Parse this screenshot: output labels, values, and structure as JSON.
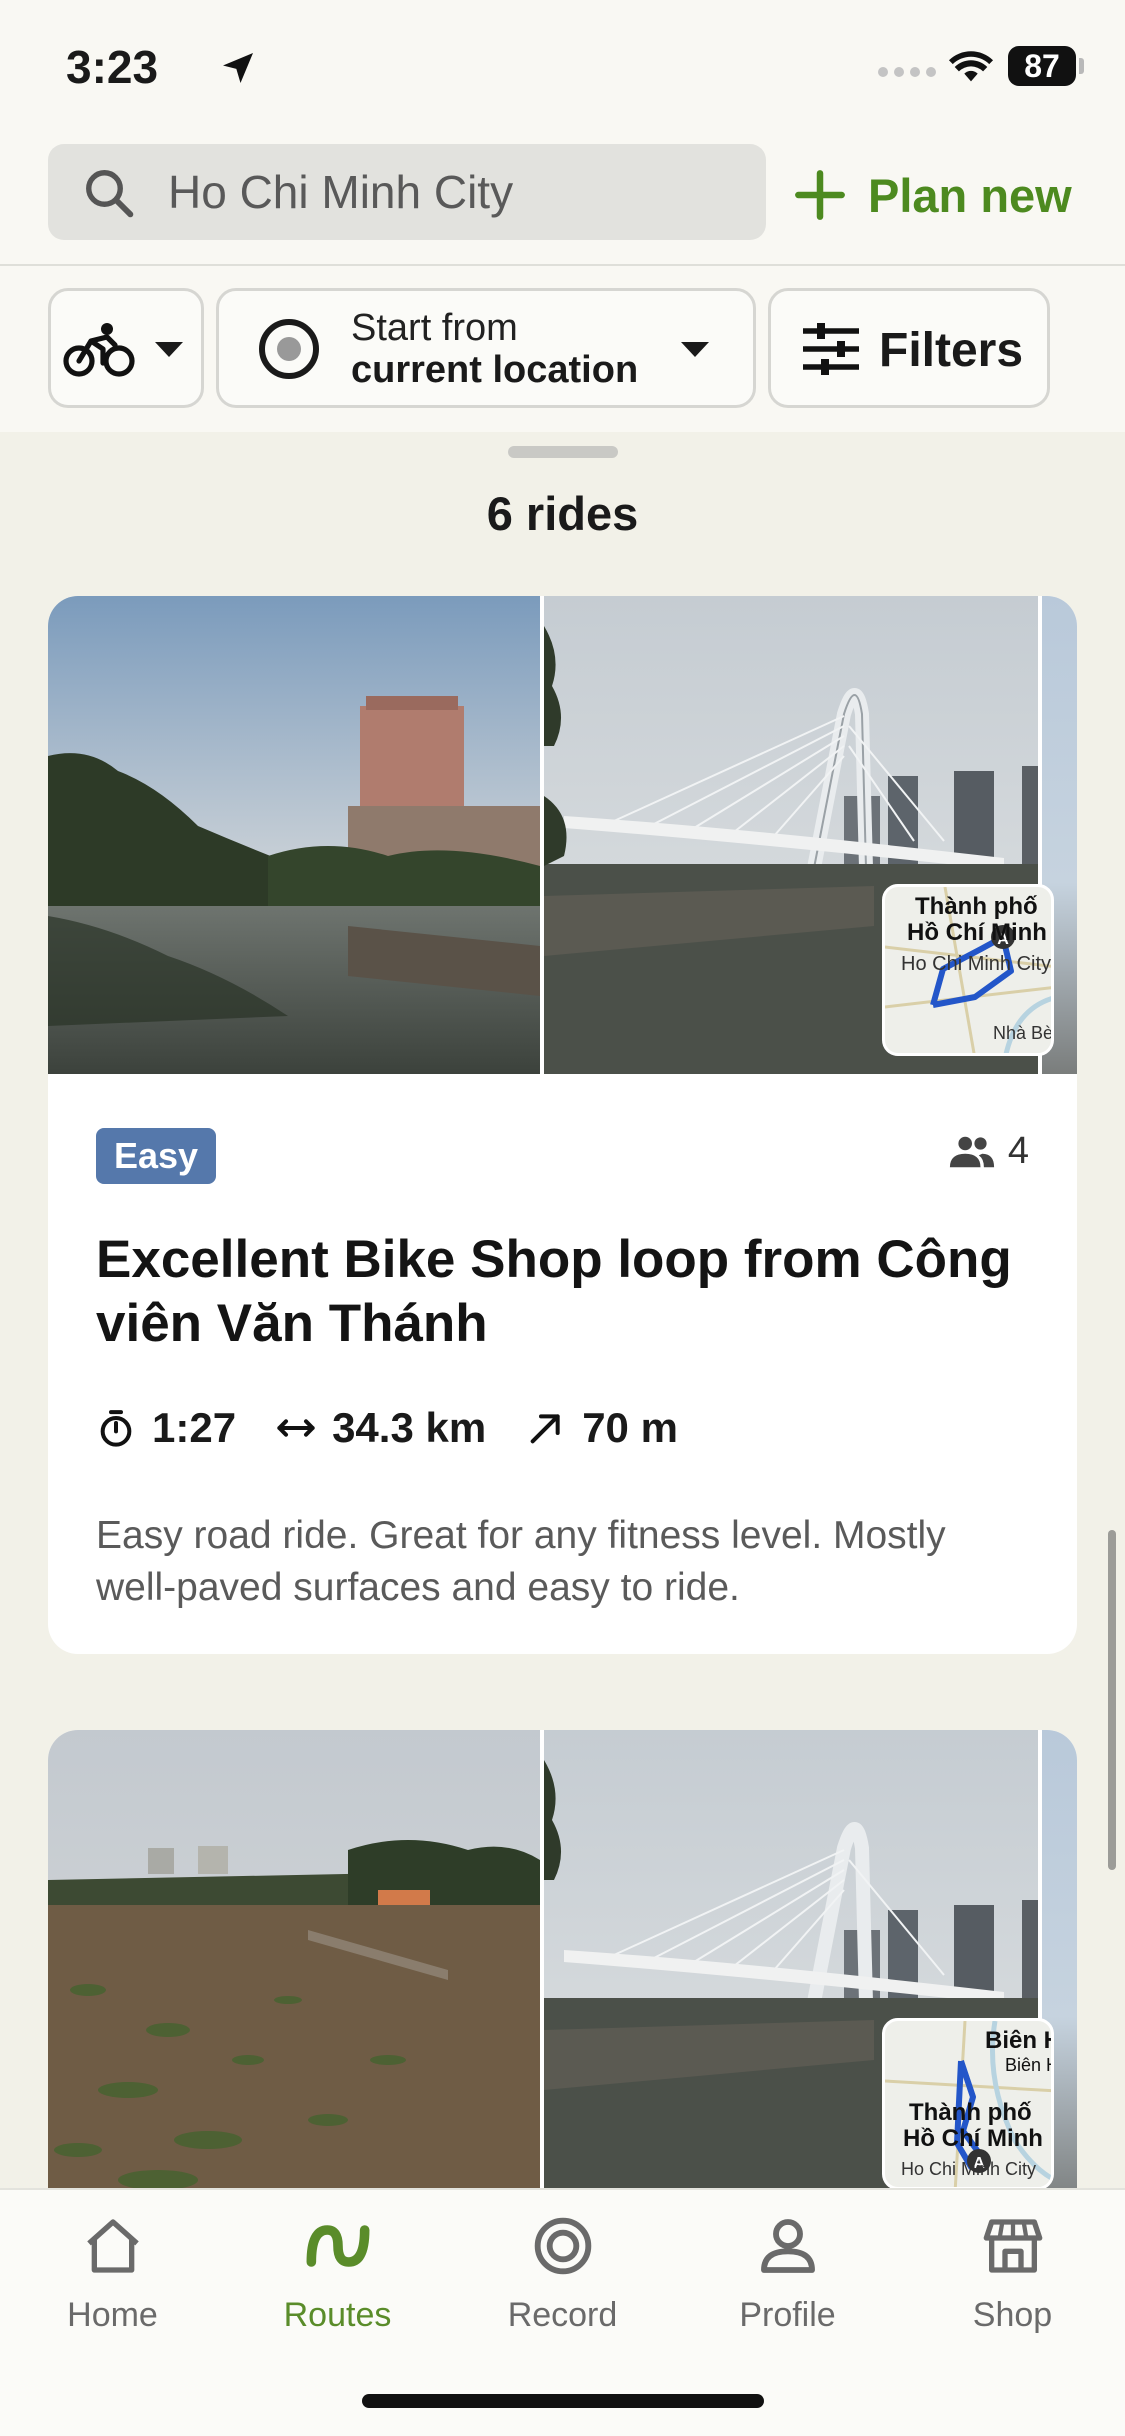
{
  "status_bar": {
    "time": "3:23",
    "battery": "87",
    "location_icon": "location-arrow-icon",
    "wifi_icon": "wifi-icon"
  },
  "header": {
    "search": {
      "value": "",
      "placeholder": "Ho Chi Minh City",
      "icon": "search-icon"
    },
    "plan_new_label": "Plan new"
  },
  "filters": {
    "sport_icon": "bike-icon",
    "start_line1": "Start from",
    "start_line2": "current location",
    "filters_label": "Filters"
  },
  "results": {
    "count_label": "6 rides"
  },
  "rides": [
    {
      "difficulty": "Easy",
      "riders": "4",
      "title": "Excellent Bike Shop loop from Công viên Văn Thánh",
      "duration": "1:27",
      "distance": "34.3 km",
      "elevation": "70 m",
      "description": "Easy road ride. Great for any fitness level. Mostly well-paved surfaces and easy to ride.",
      "map_labels": [
        "Thành phố",
        "Hồ Chí Minh",
        "Ho Chi Minh City",
        "Nhà Bè"
      ]
    },
    {
      "map_labels": [
        "Biên H",
        "Biên H",
        "Thành phố",
        "Hồ Chí Minh",
        "Ho Chi Minh City"
      ]
    }
  ],
  "tabbar": {
    "tabs": [
      {
        "label": "Home",
        "icon": "home-icon",
        "active": false
      },
      {
        "label": "Routes",
        "icon": "routes-icon",
        "active": true
      },
      {
        "label": "Record",
        "icon": "record-icon",
        "active": false
      },
      {
        "label": "Profile",
        "icon": "profile-icon",
        "active": false
      },
      {
        "label": "Shop",
        "icon": "shop-icon",
        "active": false
      }
    ]
  },
  "colors": {
    "accent": "#5a8c2a",
    "easy_badge": "#5578ab",
    "sheet_bg": "#f2f1e8",
    "route": "#2356c9"
  }
}
